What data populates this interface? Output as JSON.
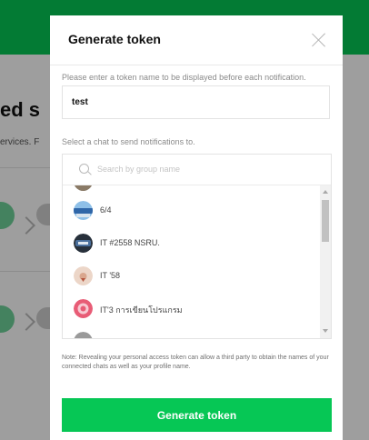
{
  "background_page": {
    "heading": "ed s",
    "subtext": "ervices. F"
  },
  "modal": {
    "title": "Generate token",
    "token_name": {
      "label": "Please enter a token name to be displayed before each notification.",
      "value": "test"
    },
    "chat_select": {
      "label": "Select a chat to send notifications to.",
      "search_placeholder": "Search by group name",
      "items": [
        {
          "name": "",
          "avatar_color": "#8fa4b8"
        },
        {
          "name": "6/4",
          "avatar_color": "#2f66a8"
        },
        {
          "name": "IT #2558 NSRU.",
          "avatar_color": "#27303b"
        },
        {
          "name": "IT '58",
          "avatar_color": "#d9a78e"
        },
        {
          "name": "IT'3 การเขียนโปรแกรม",
          "avatar_color": "#e85c76"
        },
        {
          "name": "",
          "avatar_color": "#9a9a9a"
        }
      ]
    },
    "note": "Note: Revealing your personal access token can allow a third party to obtain the names of your connected chats as well as your profile name.",
    "generate_label": "Generate token"
  },
  "colors": {
    "brand_green": "#06c755",
    "overlay": "rgba(0,0,0,0.38)"
  },
  "icons": [
    "close-icon",
    "search-icon",
    "scroll-up-arrow-icon",
    "scroll-down-arrow-icon"
  ]
}
